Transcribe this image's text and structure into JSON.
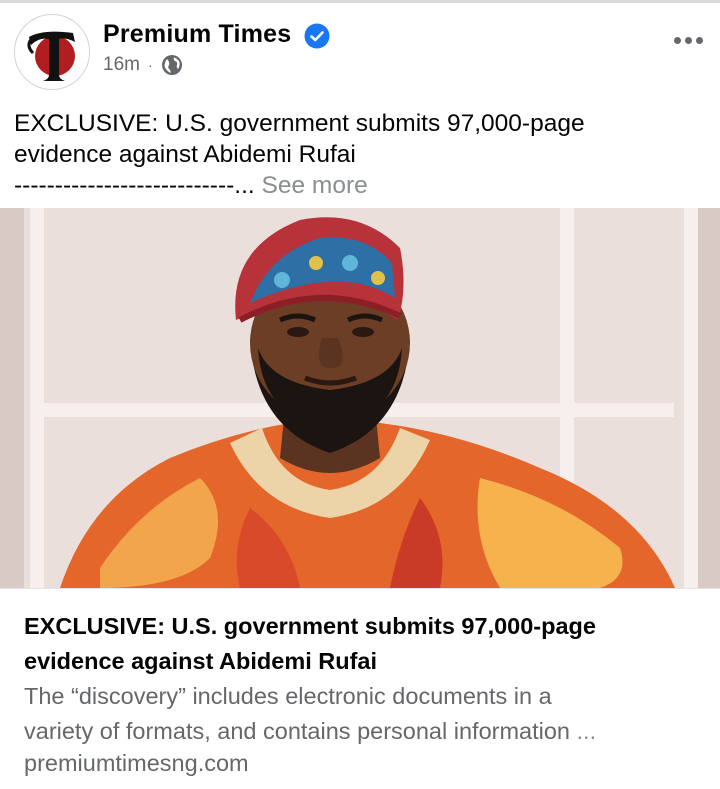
{
  "post": {
    "page_name": "Premium Times",
    "time": "16m",
    "separator": "·",
    "text_line1": "EXCLUSIVE: U.S. government submits 97,000-page",
    "text_line2": "evidence against Abidemi Rufai",
    "text_line3": "---------------------------...",
    "see_more": "See more"
  },
  "icons": {
    "avatar_logo": "premium-times-logo",
    "verified": "verified-badge-icon",
    "privacy": "globe-icon",
    "more": "more-options-icon"
  },
  "link_preview": {
    "title": "EXCLUSIVE: U.S. government submits 97,000-page evidence against Abidemi Rufai",
    "description_line1": "The “discovery” includes electronic documents in a",
    "description_line2": "variety of formats, and contains personal information",
    "ellipsis": " ...",
    "domain": "premiumtimesng.com"
  },
  "colors": {
    "text_primary": "#050505",
    "text_secondary": "#65676b",
    "verified_blue": "#1877f2",
    "logo_red": "#b11e22"
  }
}
